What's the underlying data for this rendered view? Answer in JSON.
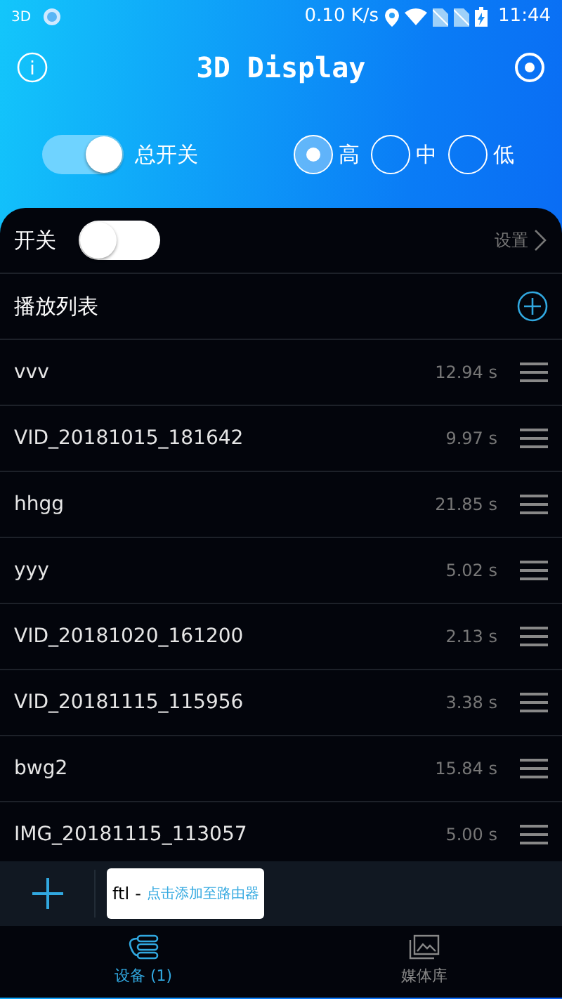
{
  "status_bar": {
    "left_text": "3D",
    "speed": "0.10 K/s",
    "time": "11:44"
  },
  "header": {
    "title": "3D Display"
  },
  "master_switch": {
    "label": "总开关",
    "on": true
  },
  "quality": [
    {
      "label": "高",
      "selected": true
    },
    {
      "label": "中",
      "selected": false
    },
    {
      "label": "低",
      "selected": false
    }
  ],
  "switch_row": {
    "label": "开关",
    "on": false,
    "settings_label": "设置"
  },
  "playlist": {
    "title": "播放列表",
    "items": [
      {
        "name": "vvv",
        "duration": "12.94 s"
      },
      {
        "name": "VID_20181015_181642",
        "duration": "9.97 s"
      },
      {
        "name": "hhgg",
        "duration": "21.85 s"
      },
      {
        "name": "yyy",
        "duration": "5.02 s"
      },
      {
        "name": "VID_20181020_161200",
        "duration": "2.13 s"
      },
      {
        "name": "VID_20181115_115956",
        "duration": "3.38 s"
      },
      {
        "name": "bwg2",
        "duration": "15.84 s"
      },
      {
        "name": "IMG_20181115_113057",
        "duration": "5.00 s"
      }
    ]
  },
  "device": {
    "name": "ftl",
    "separator": "-",
    "hint": "点击添加至路由器"
  },
  "tabs": [
    {
      "label": "设备 (1)",
      "selected": true,
      "kind": "devices"
    },
    {
      "label": "媒体库",
      "selected": false,
      "kind": "media"
    }
  ]
}
